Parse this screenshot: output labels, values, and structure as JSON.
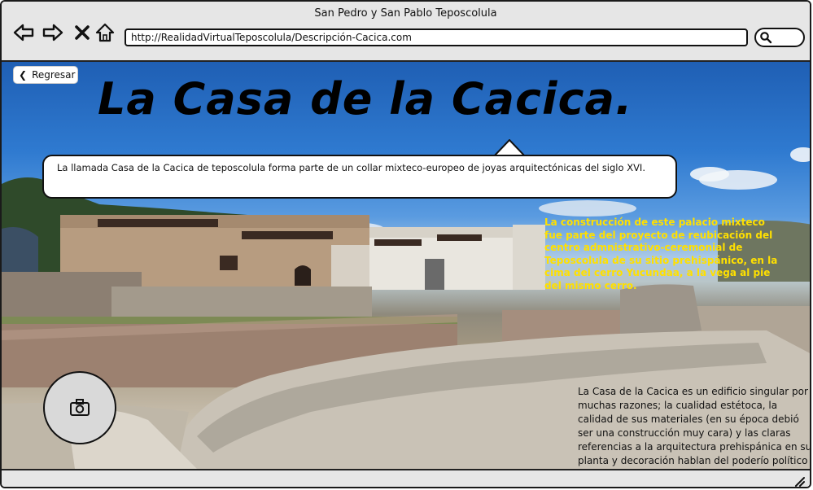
{
  "window": {
    "title": "San Pedro y San Pablo Teposcolula"
  },
  "toolbar": {
    "back_icon": "arrow-left-icon",
    "forward_icon": "arrow-right-icon",
    "stop_icon": "close-icon",
    "home_icon": "home-icon",
    "url": "http://RealidadVirtualTeposcolula/Descripción-Cacica.com",
    "search_icon": "search-icon"
  },
  "page": {
    "back_label": "Regresar",
    "title": "La Casa de la Cacica.",
    "bubble_text": "La llamada Casa de la Cacica de teposcolula forma parte de un collar mixteco-europeo de joyas arquitectónicas del siglo XVI.",
    "yellow_text": "La construcción de este palacio mixteco fue parte del proyecto de reubicación del centro admnistrativo-ceremonial de Teposcolula de su sitio prehispánico, en la cima del cerro Yucundaa, a la vega al pie del mismo cerro.",
    "dark_text": "La Casa de la Cacica es un edificio singular por muchas razones; la cualidad estétoca, la calidad de sus materiales (en su época debió ser una construcción muy cara) y las claras referencias a la arquitectura prehispánica en su planta y decoración hablan del poderío político  y",
    "camera_icon": "camera-icon"
  },
  "colors": {
    "highlight_text": "#ffe000",
    "chrome": "#e6e6e6",
    "border": "#111111"
  }
}
